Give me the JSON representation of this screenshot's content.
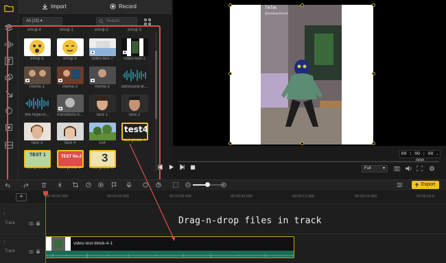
{
  "topbar": {
    "import_label": "Import",
    "record_label": "Record"
  },
  "media": {
    "filter_value": "All (23)",
    "search_placeholder": "Search",
    "header_row": [
      "emoji-4",
      "emoji-1",
      "emoji-2",
      "emoji-3"
    ],
    "items": [
      {
        "name": "emoji-5"
      },
      {
        "name": "emoji-6"
      },
      {
        "name": "video-test-7"
      },
      {
        "name": "video-test-1"
      },
      {
        "name": "meme-1"
      },
      {
        "name": "meme-3"
      },
      {
        "name": "meme-2"
      },
      {
        "name": "bensound-lit..."
      },
      {
        "name": "the-hope-lo..."
      },
      {
        "name": "transitions-fi..."
      },
      {
        "name": "face 1"
      },
      {
        "name": "face 2"
      },
      {
        "name": "face 3"
      },
      {
        "name": "face 4"
      },
      {
        "name": "154"
      },
      {
        "name": "test-photo-4",
        "thumb_text": "test4",
        "selected": true
      },
      {
        "name": "test-photo-1",
        "thumb_text": "TEST 1"
      },
      {
        "name": "test-photo-2",
        "thumb_text": "TEST No.2"
      },
      {
        "name": "test-photo-3",
        "thumb_text": "3"
      }
    ]
  },
  "preview": {
    "watermark": "TikTok",
    "watermark_sub": "@meabandoned",
    "timecode": "00 : 00 : 00 . 000",
    "quality": "Full"
  },
  "timeline": {
    "export_label": "Export",
    "ruler": [
      "00:00:00.000",
      "00:00:03.000",
      "00:00:06.000",
      "00:00:09.000",
      "00:00:12.000",
      "00:00:15.000",
      "00:00:18.0"
    ],
    "track_label": "Track",
    "track_numbers": [
      "2",
      "1"
    ],
    "clip_name": "video-test-tiktok-4-1"
  },
  "annotation": "Drag-n-drop files in track",
  "colors": {
    "accent": "#f2c21b",
    "annotation_red": "#e0504f",
    "wave": "#1d6b55"
  }
}
